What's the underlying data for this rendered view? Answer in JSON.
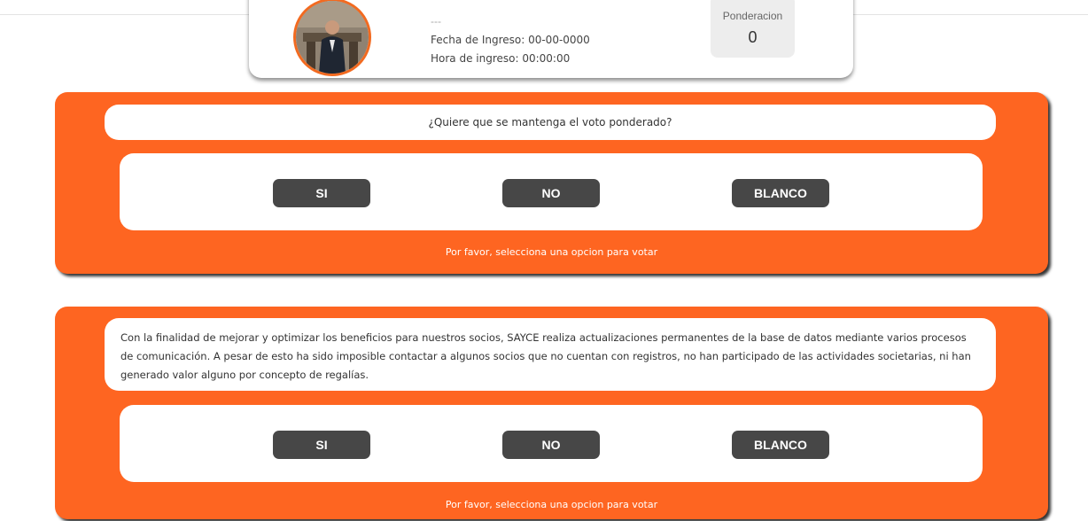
{
  "profile": {
    "name_placeholder": "---",
    "fecha": "Fecha de Ingreso: 00-00-0000",
    "hora": "Hora de ingreso: 00:00:00",
    "ponderacion_label": "Ponderacion",
    "ponderacion_value": "0",
    "accent_color": "#f26a20"
  },
  "votes": [
    {
      "question": "¿Quiere que se mantenga el voto ponderado?",
      "options": {
        "si": "SI",
        "no": "NO",
        "blanco": "BLANCO"
      },
      "hint": "Por favor, selecciona una opcion para votar"
    },
    {
      "question": "Con la finalidad de mejorar y optimizar los beneficios para nuestros socios, SAYCE realiza actualizaciones permanentes de la base de datos mediante varios procesos de comunicación. A pesar de esto ha sido imposible contactar a algunos socios que no cuentan con registros, no han participado de las actividades societarias, ni han generado valor alguno por concepto de regalías.",
      "options": {
        "si": "SI",
        "no": "NO",
        "blanco": "BLANCO"
      },
      "hint": "Por favor, selecciona una opcion para votar"
    }
  ],
  "colors": {
    "panel": "#fe6521",
    "button": "#474747"
  }
}
